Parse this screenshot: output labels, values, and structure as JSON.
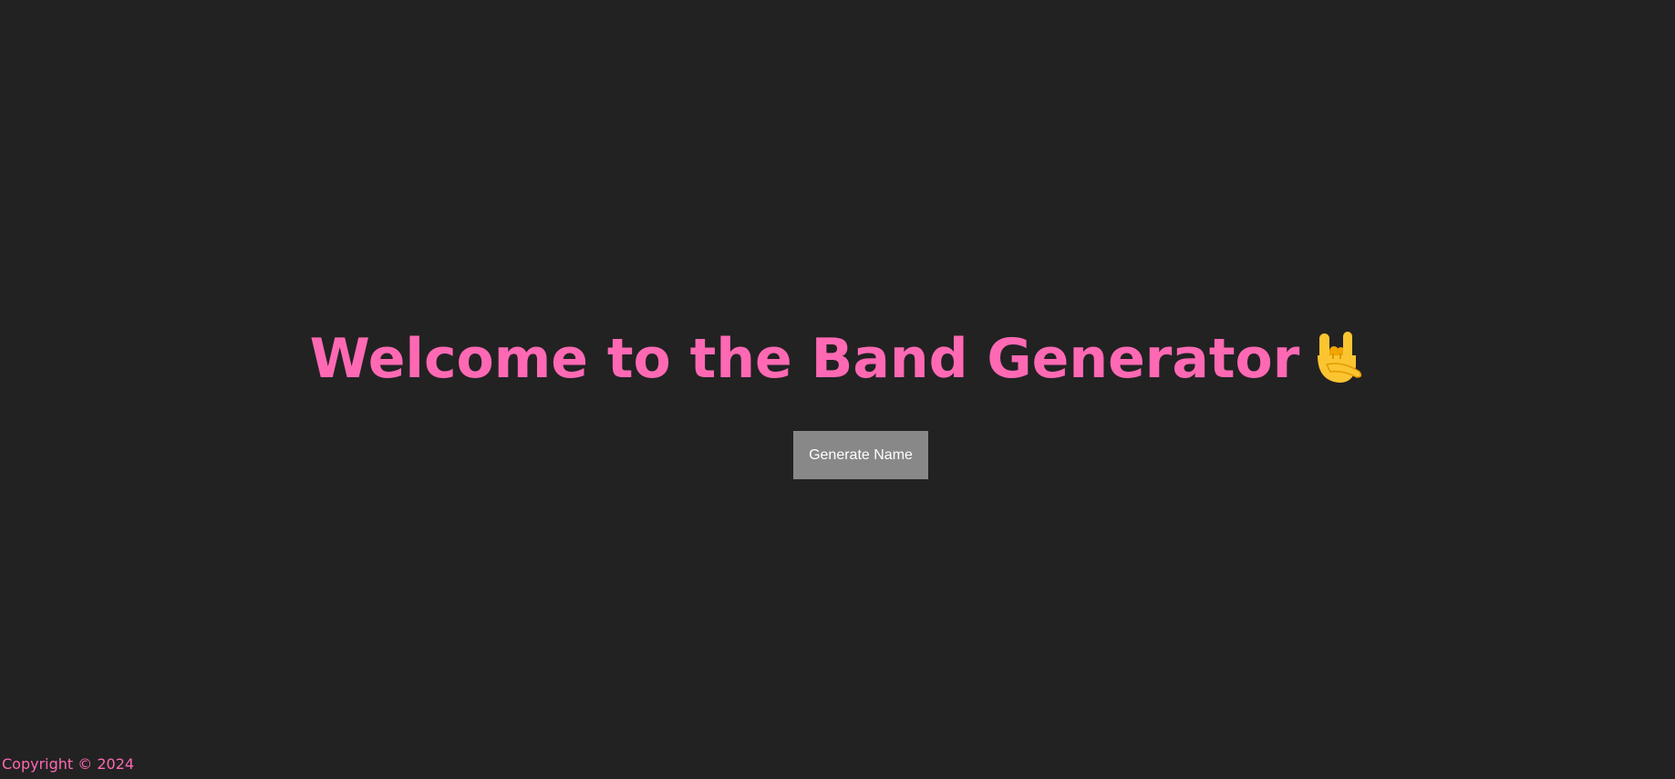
{
  "header": {
    "title": "Welcome to the Band Generator",
    "title_icon": "rock-on-hand-icon"
  },
  "main": {
    "generate_button_label": "Generate Name"
  },
  "footer": {
    "copyright": "Copyright © 2024"
  },
  "colors": {
    "background": "#222222",
    "accent": "#ff69b4",
    "button_bg": "#888888",
    "button_text": "#ffffff",
    "emoji_yellow": "#fbc531"
  }
}
